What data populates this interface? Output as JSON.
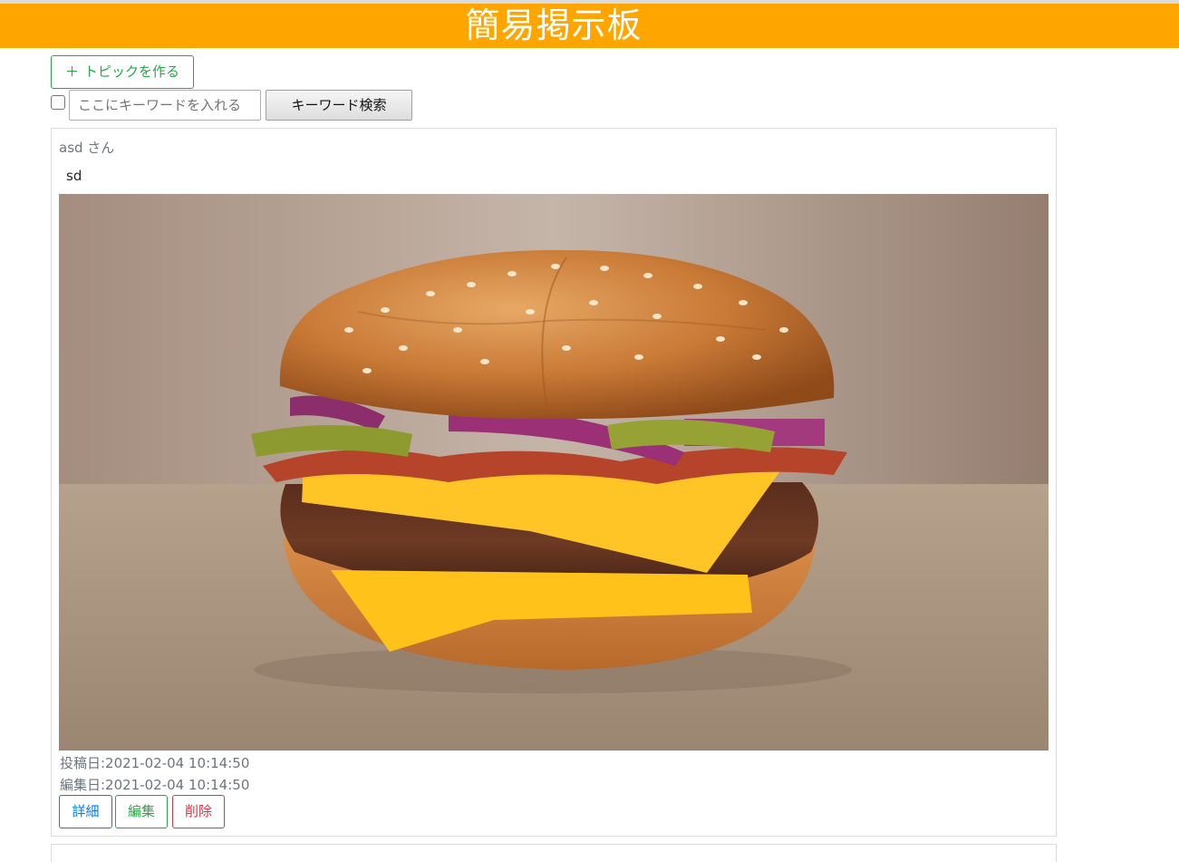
{
  "header": {
    "title": "簡易掲示板",
    "color": "#ffa500"
  },
  "toolbar": {
    "create_label": "トピックを作る",
    "create_icon": "plus-icon",
    "search_placeholder": "ここにキーワードを入れる",
    "search_value": "",
    "search_button": "キーワード検索",
    "checkbox_checked": false
  },
  "posts": [
    {
      "author": "asd さん",
      "body": "sd",
      "image": "burger-photo",
      "created": "投稿日:2021-02-04 10:14:50",
      "edited": "編集日:2021-02-04 10:14:50",
      "actions": {
        "detail": "詳細",
        "edit": "編集",
        "delete": "削除"
      }
    }
  ],
  "colors": {
    "detail": "#007bff",
    "edit": "#28a745",
    "delete": "#dc3545"
  }
}
